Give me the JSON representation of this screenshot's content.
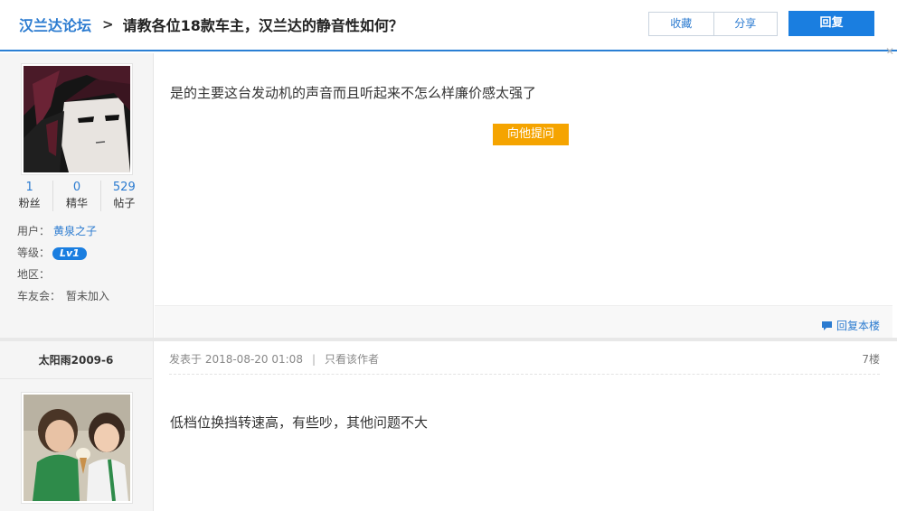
{
  "header": {
    "forum_name": "汉兰达论坛",
    "separator": ">",
    "thread_title": "请教各位18款车主，汉兰达的静音性如何？",
    "favorite_label": "收藏",
    "share_label": "分享",
    "reply_label": "回复"
  },
  "post1": {
    "stats": [
      {
        "value": "1",
        "label": "粉丝"
      },
      {
        "value": "0",
        "label": "精华"
      },
      {
        "value": "529",
        "label": "帖子"
      }
    ],
    "info": {
      "user_label": "用户：",
      "user_name": "黄泉之子",
      "level_label": "等级：",
      "level_badge": "Lv1",
      "region_label": "地区：",
      "region_value": "",
      "club_label": "车友会：",
      "club_value": "暂未加入"
    },
    "content": "是的主要这台发动机的声音而且听起来不怎么样廉价感太强了",
    "ask_label": "向他提问",
    "reply_floor_label": "回复本楼"
  },
  "post2": {
    "user_name": "太阳雨2009-6",
    "meta_posted": "发表于 2018-08-20 01:08",
    "meta_bar": "|",
    "author_only_label": "只看该作者",
    "floor": "7楼",
    "content": "低档位换挡转速高，有些吵，其他问题不大"
  },
  "colors": {
    "accent": "#1a7ee0",
    "link": "#2b7bd0",
    "ask_button": "#f5a400"
  }
}
